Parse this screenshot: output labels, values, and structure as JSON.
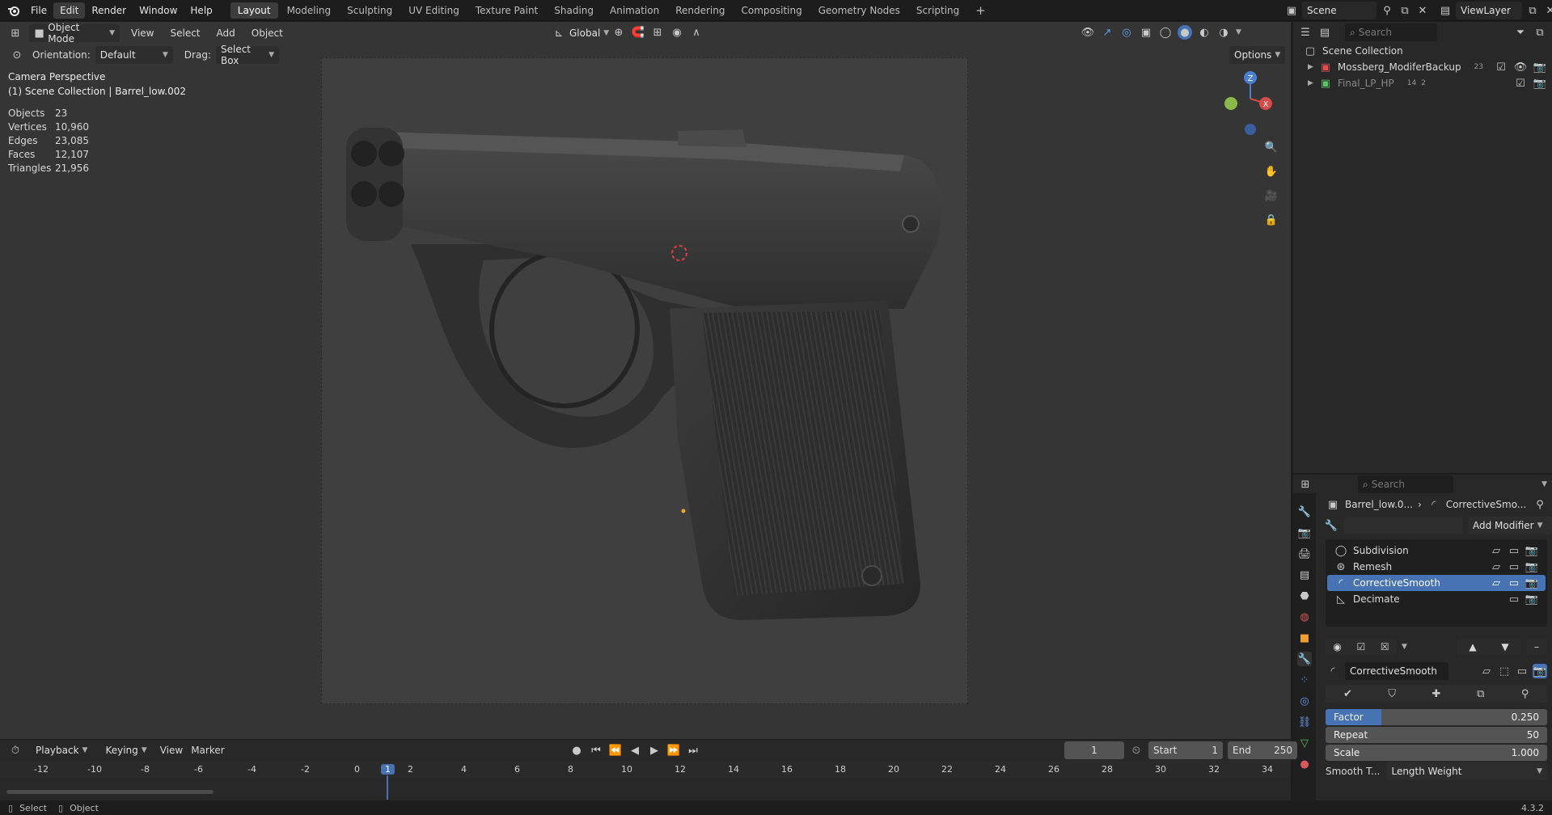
{
  "topbar": {
    "menus": [
      "File",
      "Edit",
      "Render",
      "Window",
      "Help"
    ],
    "workspaces": [
      "Layout",
      "Modeling",
      "Sculpting",
      "UV Editing",
      "Texture Paint",
      "Shading",
      "Animation",
      "Rendering",
      "Compositing",
      "Geometry Nodes",
      "Scripting"
    ],
    "add_tab": "+",
    "scene": "Scene",
    "view_layer": "ViewLayer"
  },
  "viewport_header": {
    "mode": "Object Mode",
    "menus": [
      "View",
      "Select",
      "Add",
      "Object"
    ],
    "transform_orientation": "Global",
    "orientation_label": "Orientation:",
    "orientation_value": "Default",
    "drag_label": "Drag:",
    "drag_value": "Select Box",
    "options": "Options"
  },
  "overlay": {
    "view_name": "Camera Perspective",
    "collection_line": "(1) Scene Collection | Barrel_low.002",
    "stats": [
      {
        "label": "Objects",
        "value": "23"
      },
      {
        "label": "Vertices",
        "value": "10,960"
      },
      {
        "label": "Edges",
        "value": "23,085"
      },
      {
        "label": "Faces",
        "value": "12,107"
      },
      {
        "label": "Triangles",
        "value": "21,956"
      }
    ]
  },
  "gizmo": {
    "z": "Z",
    "x": "X"
  },
  "outliner": {
    "search_placeholder": "Search",
    "root": "Scene Collection",
    "items": [
      {
        "name": "Mossberg_ModiferBackup",
        "count": "23"
      },
      {
        "name": "Final_LP_HP",
        "count_a": "14",
        "count_b": "2"
      }
    ]
  },
  "properties": {
    "search_placeholder": "Search",
    "breadcrumb_object": "Barrel_low.0...",
    "breadcrumb_modifier": "CorrectiveSmo...",
    "add_modifier": "Add Modifier",
    "modifiers": [
      {
        "name": "Subdivision",
        "active": false
      },
      {
        "name": "Remesh",
        "active": false
      },
      {
        "name": "CorrectiveSmooth",
        "active": true
      },
      {
        "name": "Decimate",
        "active": false
      }
    ],
    "panel_name": "CorrectiveSmooth",
    "fields": [
      {
        "label": "Factor",
        "value": "0.250",
        "fill": 0.25
      },
      {
        "label": "Repeat",
        "value": "50",
        "fill": 0
      },
      {
        "label": "Scale",
        "value": "1.000",
        "fill": 0
      }
    ],
    "smooth_type_label": "Smooth T...",
    "smooth_type_value": "Length Weight"
  },
  "timeline": {
    "menus": [
      "Playback",
      "Keying",
      "View",
      "Marker"
    ],
    "current_frame": "1",
    "start_label": "Start",
    "start_value": "1",
    "end_label": "End",
    "end_value": "250",
    "ticks": [
      "-12",
      "-10",
      "-8",
      "-6",
      "-4",
      "-2",
      "0",
      "1",
      "2",
      "4",
      "6",
      "8",
      "10",
      "12",
      "14",
      "16",
      "18",
      "20",
      "22",
      "24",
      "26",
      "28",
      "30",
      "32",
      "34"
    ]
  },
  "statusbar": {
    "left_a": "Select",
    "left_b": "Object",
    "version": "4.3.2"
  },
  "colors": {
    "accent": "#4772b3",
    "background": "#1d1d1d",
    "viewport": "#3d3d3d"
  }
}
